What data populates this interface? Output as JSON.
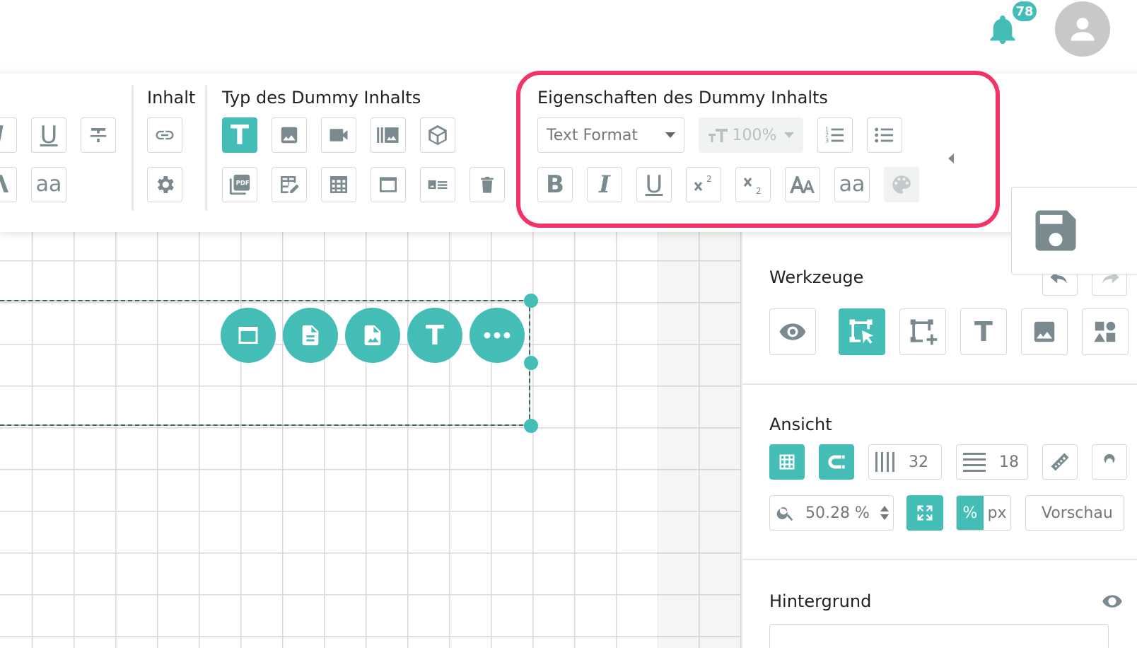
{
  "header": {
    "notification_count": "78"
  },
  "ribbon": {
    "groups": {
      "content": "Inhalt",
      "dummy_type": "Typ des Dummy Inhalts",
      "dummy_properties": "Eigenschaften des Dummy Inhalts"
    },
    "properties": {
      "text_format_select": "Text Format",
      "font_size_value": "100%"
    },
    "icons": {
      "text_glyph": "T",
      "lowercase_glyph": "aa",
      "bold_glyph": "B",
      "italic_glyph": "I",
      "underline_glyph": "U"
    }
  },
  "panel": {
    "tools_title": "Werkzeuge",
    "text_tool_glyph": "T",
    "view_title": "Ansicht",
    "columns_value": "32",
    "rows_value": "18",
    "zoom_value": "50.28 %",
    "unit_percent": "%",
    "unit_px": "px",
    "preview_label": "Vorschau",
    "background_title": "Hintergrund"
  },
  "colors": {
    "accent": "#43bdb6",
    "highlight": "#f2336a",
    "icon_gray": "#7a8a8e"
  }
}
